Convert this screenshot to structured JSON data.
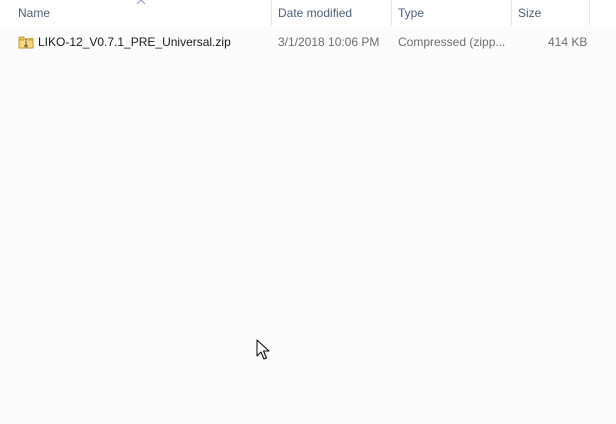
{
  "columns": {
    "name": "Name",
    "date_modified": "Date modified",
    "type": "Type",
    "size": "Size"
  },
  "sort": {
    "column": "name",
    "direction": "ascending"
  },
  "files": [
    {
      "name": "LIKO-12_V0.7.1_PRE_Universal.zip",
      "date_modified": "3/1/2018 10:06 PM",
      "type": "Compressed (zipp...",
      "size": "414 KB",
      "icon": "zip-folder-icon"
    }
  ],
  "colors": {
    "header_text": "#4c607a",
    "name_text": "#1a1a1a",
    "meta_text": "#6d6d6d",
    "background": "#fcfcfc"
  }
}
